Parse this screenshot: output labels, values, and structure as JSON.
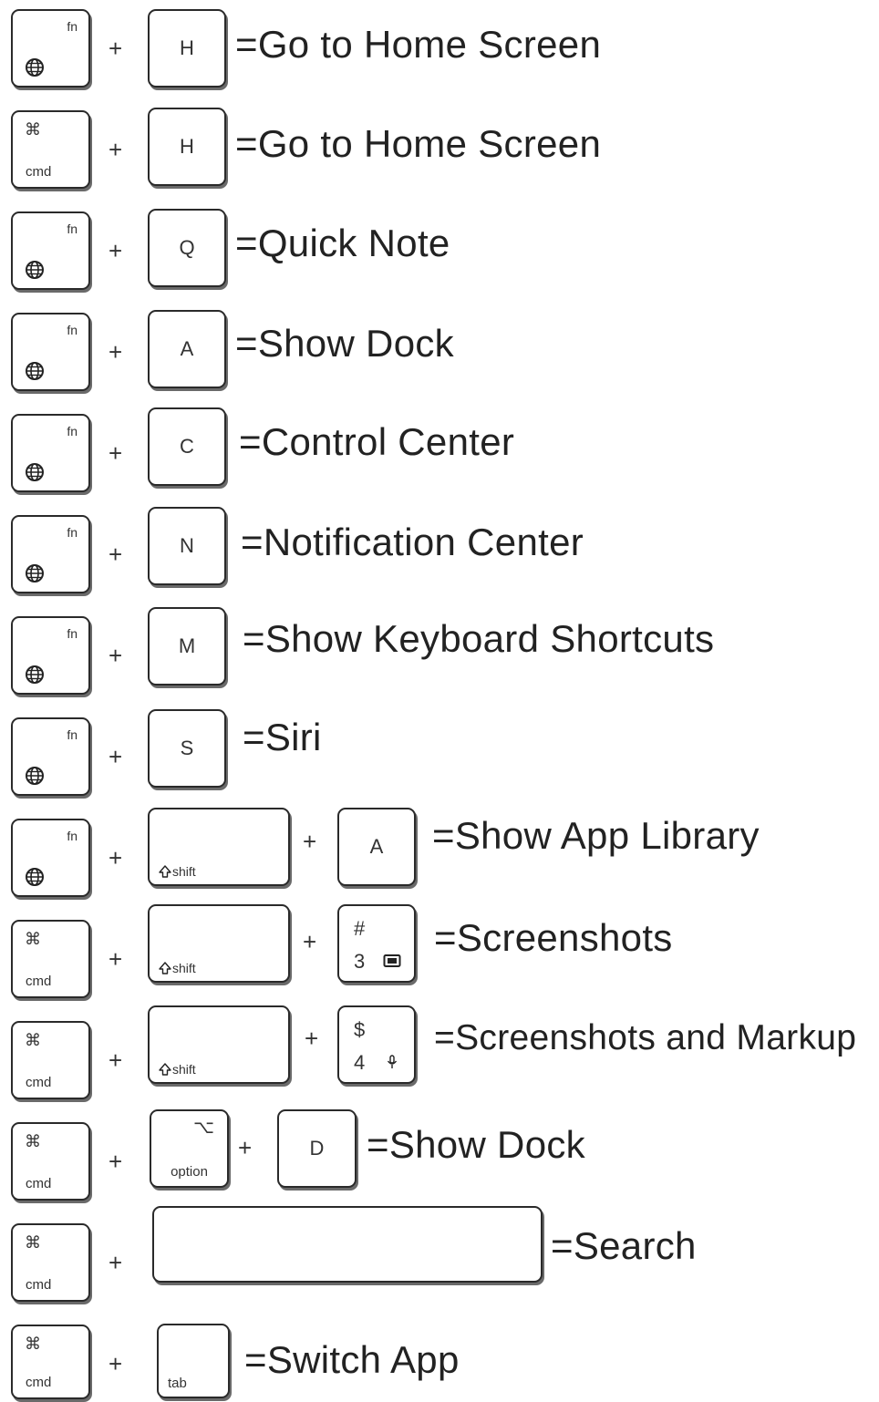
{
  "keys": {
    "fn": "fn",
    "cmd_symbol": "⌘",
    "cmd": "cmd",
    "shift": "shift",
    "option_symbol": "⌥",
    "option": "option",
    "tab": "tab",
    "H": "H",
    "Q": "Q",
    "A": "A",
    "C": "C",
    "N": "N",
    "M": "M",
    "S": "S",
    "D": "D",
    "hash": "#",
    "three": "3",
    "dollar": "$",
    "four": "4"
  },
  "plus": "+",
  "shortcuts": [
    {
      "desc": "=Go to Home Screen"
    },
    {
      "desc": "=Go to Home Screen"
    },
    {
      "desc": "=Quick Note"
    },
    {
      "desc": "=Show Dock"
    },
    {
      "desc": "=Control Center"
    },
    {
      "desc": "=Notification Center"
    },
    {
      "desc": "=Show Keyboard Shortcuts"
    },
    {
      "desc": "=Siri"
    },
    {
      "desc": "=Show App Library"
    },
    {
      "desc": "=Screenshots"
    },
    {
      "desc": "=Screenshots and Markup"
    },
    {
      "desc": "=Show Dock"
    },
    {
      "desc": "=Search"
    },
    {
      "desc": "=Switch App"
    }
  ],
  "icons": {
    "globe": "globe-icon",
    "shift": "shift-arrow-icon",
    "screenshot": "screenshot-icon",
    "microphone": "microphone-icon"
  }
}
